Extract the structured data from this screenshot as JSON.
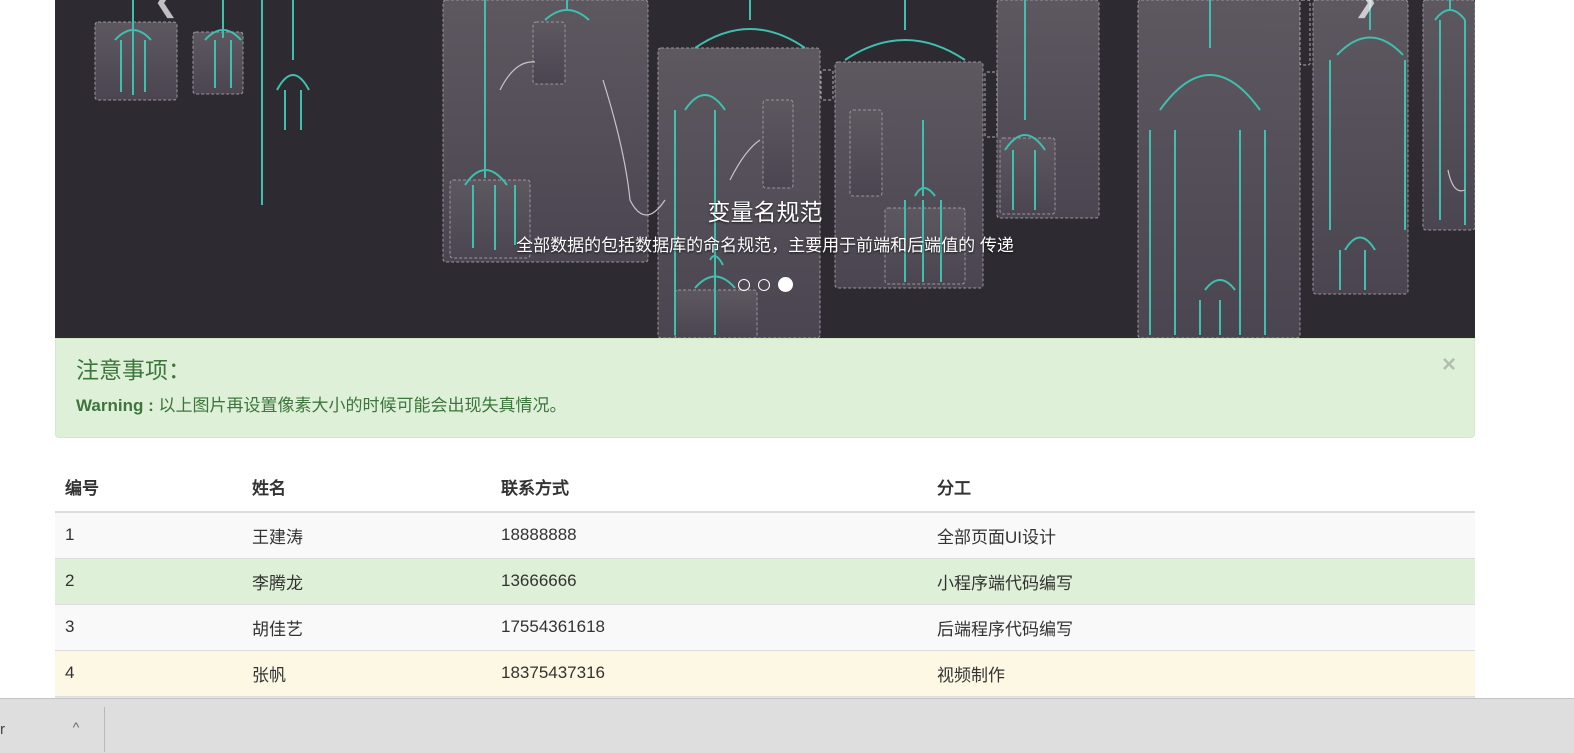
{
  "carousel": {
    "caption_title": "变量名规范",
    "caption_text": "全部数据的包括数据库的命名规范，主要用于前端和后端值的 传递",
    "indicator_count": 3,
    "active_index": 2,
    "prev_icon": "chevron-left-icon",
    "next_icon": "chevron-right-icon",
    "prev_glyph": "❮",
    "next_glyph": "❯"
  },
  "alert": {
    "title": "注意事项：",
    "label": "Warning :",
    "text": " 以上图片再设置像素大小的时候可能会出现失真情况。",
    "close": "×"
  },
  "table": {
    "headers": [
      "编号",
      "姓名",
      "联系方式",
      "分工"
    ],
    "rows": [
      {
        "id": "1",
        "name": "王建涛",
        "contact": "18888888",
        "role": "全部页面UI设计",
        "style": "striped"
      },
      {
        "id": "2",
        "name": "李腾龙",
        "contact": "13666666",
        "role": "小程序端代码编写",
        "style": "success"
      },
      {
        "id": "3",
        "name": "胡佳艺",
        "contact": "17554361618",
        "role": "后端程序代码编写",
        "style": "striped"
      },
      {
        "id": "4",
        "name": "张帆",
        "contact": "18375437316",
        "role": "视频制作",
        "style": "warning"
      },
      {
        "id": "",
        "name": "",
        "contact": "",
        "role": "",
        "style": "info"
      }
    ]
  },
  "bottom_bar": {
    "fragment": "r",
    "chevron": "^"
  },
  "colors": {
    "alert_bg": "#dff0d8",
    "alert_text": "#3c763d",
    "carousel_bg": "#2e2a31",
    "diagram_line": "#3fbfae"
  }
}
